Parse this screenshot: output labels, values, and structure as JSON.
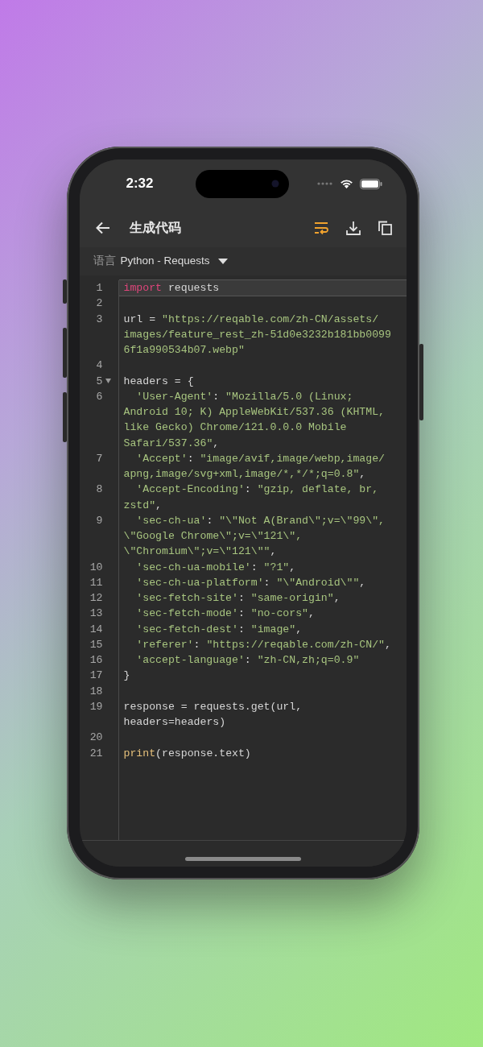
{
  "status_bar": {
    "time": "2:32"
  },
  "app_bar": {
    "title": "生成代码",
    "actions": [
      {
        "kind": "wrap",
        "active": true
      },
      {
        "kind": "download",
        "active": false
      },
      {
        "kind": "copy",
        "active": false
      }
    ]
  },
  "language": {
    "label": "语言",
    "value": "Python - Requests"
  },
  "code": {
    "lines": [
      {
        "number": "1",
        "current": true,
        "foldable": false,
        "rows": [
          {
            "parts": [
              {
                "kind": "keyword",
                "text": "import"
              },
              {
                "kind": "plain",
                "text": " requests"
              }
            ]
          }
        ]
      },
      {
        "number": "2",
        "current": false,
        "foldable": false
      },
      {
        "number": "3",
        "current": false,
        "foldable": false,
        "rows": [
          {
            "parts": [
              {
                "kind": "plain",
                "text": "url = "
              },
              {
                "kind": "string",
                "text": "\"https://reqable.com/zh-CN/assets/"
              }
            ]
          },
          {
            "parts": [
              {
                "kind": "string",
                "text": "images/feature_rest_zh-51d0e3232b181bb0099"
              }
            ]
          },
          {
            "parts": [
              {
                "kind": "string",
                "text": "6f1a990534b07.webp\""
              }
            ]
          }
        ]
      },
      {
        "number": "4",
        "current": false,
        "foldable": false
      },
      {
        "number": "5",
        "current": false,
        "foldable": true,
        "rows": [
          {
            "parts": [
              {
                "kind": "plain",
                "text": "headers = {"
              }
            ]
          }
        ]
      },
      {
        "number": "6",
        "current": false,
        "foldable": false,
        "indented": true,
        "rows": [
          {
            "parts": [
              {
                "kind": "string",
                "text": "'User-Agent'"
              },
              {
                "kind": "plain",
                "text": ": "
              },
              {
                "kind": "string",
                "text": "\"Mozilla/5.0 (Linux;"
              }
            ]
          },
          {
            "parts": [
              {
                "kind": "string",
                "text": "Android 10; K) AppleWebKit/537.36 (KHTML,"
              }
            ]
          },
          {
            "parts": [
              {
                "kind": "string",
                "text": "like Gecko) Chrome/121.0.0.0 Mobile"
              }
            ]
          },
          {
            "parts": [
              {
                "kind": "string",
                "text": "Safari/537.36\""
              },
              {
                "kind": "plain",
                "text": ","
              }
            ]
          }
        ]
      },
      {
        "number": "7",
        "current": false,
        "foldable": false,
        "indented": true,
        "rows": [
          {
            "parts": [
              {
                "kind": "string",
                "text": "'Accept'"
              },
              {
                "kind": "plain",
                "text": ": "
              },
              {
                "kind": "string",
                "text": "\"image/avif,image/webp,image/"
              }
            ]
          },
          {
            "parts": [
              {
                "kind": "string",
                "text": "apng,image/svg+xml,image/*,*/*;q=0.8\""
              },
              {
                "kind": "plain",
                "text": ","
              }
            ]
          }
        ]
      },
      {
        "number": "8",
        "current": false,
        "foldable": false,
        "indented": true,
        "rows": [
          {
            "parts": [
              {
                "kind": "string",
                "text": "'Accept-Encoding'"
              },
              {
                "kind": "plain",
                "text": ": "
              },
              {
                "kind": "string",
                "text": "\"gzip, deflate, br,"
              }
            ]
          },
          {
            "parts": [
              {
                "kind": "string",
                "text": "zstd\""
              },
              {
                "kind": "plain",
                "text": ","
              }
            ]
          }
        ]
      },
      {
        "number": "9",
        "current": false,
        "foldable": false,
        "indented": true,
        "rows": [
          {
            "parts": [
              {
                "kind": "string",
                "text": "'sec-ch-ua'"
              },
              {
                "kind": "plain",
                "text": ": "
              },
              {
                "kind": "string",
                "text": "\"\\\"Not A(Brand\\\";v=\\\"99\\\","
              }
            ]
          },
          {
            "parts": [
              {
                "kind": "string",
                "text": "\\\"Google Chrome\\\";v=\\\"121\\\","
              }
            ]
          },
          {
            "parts": [
              {
                "kind": "string",
                "text": "\\\"Chromium\\\";v=\\\"121\\\"\""
              },
              {
                "kind": "plain",
                "text": ","
              }
            ]
          }
        ]
      },
      {
        "number": "10",
        "current": false,
        "foldable": false,
        "indented": true,
        "rows": [
          {
            "parts": [
              {
                "kind": "string",
                "text": "'sec-ch-ua-mobile'"
              },
              {
                "kind": "plain",
                "text": ": "
              },
              {
                "kind": "string",
                "text": "\"?1\""
              },
              {
                "kind": "plain",
                "text": ","
              }
            ]
          }
        ]
      },
      {
        "number": "11",
        "current": false,
        "foldable": false,
        "indented": true,
        "rows": [
          {
            "parts": [
              {
                "kind": "string",
                "text": "'sec-ch-ua-platform'"
              },
              {
                "kind": "plain",
                "text": ": "
              },
              {
                "kind": "string",
                "text": "\"\\\"Android\\\"\""
              },
              {
                "kind": "plain",
                "text": ","
              }
            ]
          }
        ]
      },
      {
        "number": "12",
        "current": false,
        "foldable": false,
        "indented": true,
        "rows": [
          {
            "parts": [
              {
                "kind": "string",
                "text": "'sec-fetch-site'"
              },
              {
                "kind": "plain",
                "text": ": "
              },
              {
                "kind": "string",
                "text": "\"same-origin\""
              },
              {
                "kind": "plain",
                "text": ","
              }
            ]
          }
        ]
      },
      {
        "number": "13",
        "current": false,
        "foldable": false,
        "indented": true,
        "rows": [
          {
            "parts": [
              {
                "kind": "string",
                "text": "'sec-fetch-mode'"
              },
              {
                "kind": "plain",
                "text": ": "
              },
              {
                "kind": "string",
                "text": "\"no-cors\""
              },
              {
                "kind": "plain",
                "text": ","
              }
            ]
          }
        ]
      },
      {
        "number": "14",
        "current": false,
        "foldable": false,
        "indented": true,
        "rows": [
          {
            "parts": [
              {
                "kind": "string",
                "text": "'sec-fetch-dest'"
              },
              {
                "kind": "plain",
                "text": ": "
              },
              {
                "kind": "string",
                "text": "\"image\""
              },
              {
                "kind": "plain",
                "text": ","
              }
            ]
          }
        ]
      },
      {
        "number": "15",
        "current": false,
        "foldable": false,
        "indented": true,
        "rows": [
          {
            "parts": [
              {
                "kind": "string",
                "text": "'referer'"
              },
              {
                "kind": "plain",
                "text": ": "
              },
              {
                "kind": "string",
                "text": "\"https://reqable.com/zh-CN/\""
              },
              {
                "kind": "plain",
                "text": ","
              }
            ]
          }
        ]
      },
      {
        "number": "16",
        "current": false,
        "foldable": false,
        "indented": true,
        "rows": [
          {
            "parts": [
              {
                "kind": "string",
                "text": "'accept-language'"
              },
              {
                "kind": "plain",
                "text": ": "
              },
              {
                "kind": "string",
                "text": "\"zh-CN,zh;q=0.9\""
              }
            ]
          }
        ]
      },
      {
        "number": "17",
        "current": false,
        "foldable": false,
        "rows": [
          {
            "parts": [
              {
                "kind": "plain",
                "text": "}"
              }
            ]
          }
        ]
      },
      {
        "number": "18",
        "current": false,
        "foldable": false
      },
      {
        "number": "19",
        "current": false,
        "foldable": false,
        "rows": [
          {
            "parts": [
              {
                "kind": "plain",
                "text": "response = requests.get(url,"
              }
            ]
          },
          {
            "parts": [
              {
                "kind": "plain",
                "text": "headers=headers)"
              }
            ]
          }
        ]
      },
      {
        "number": "20",
        "current": false,
        "foldable": false
      },
      {
        "number": "21",
        "current": false,
        "foldable": false,
        "rows": [
          {
            "parts": [
              {
                "kind": "builtin",
                "text": "print"
              },
              {
                "kind": "plain",
                "text": "(response.text)"
              }
            ]
          }
        ]
      }
    ]
  }
}
